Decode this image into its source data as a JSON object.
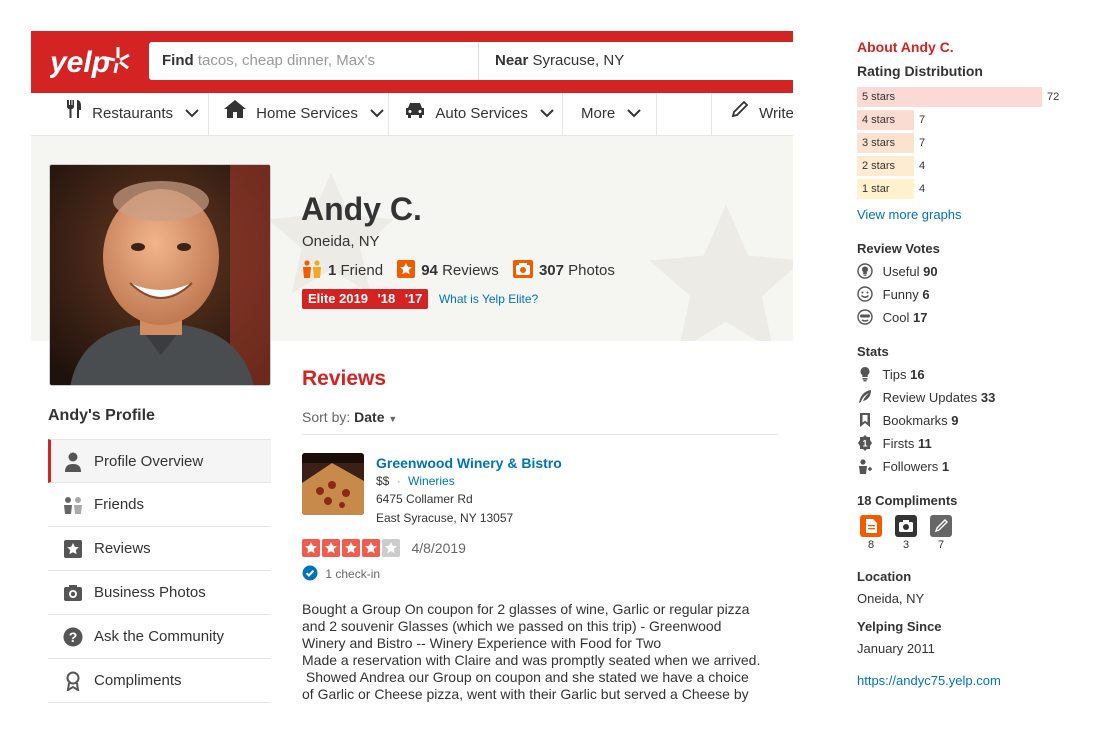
{
  "header": {
    "find_label": "Find",
    "find_placeholder": "tacos, cheap dinner, Max's",
    "near_label": "Near",
    "near_value": "Syracuse, NY"
  },
  "nav": {
    "items": [
      {
        "label": "Restaurants",
        "icon": "fork-knife-icon"
      },
      {
        "label": "Home Services",
        "icon": "house-icon"
      },
      {
        "label": "Auto Services",
        "icon": "car-icon"
      },
      {
        "label": "More",
        "icon": ""
      },
      {
        "label": "Write",
        "icon": "pencil-icon"
      }
    ]
  },
  "profile": {
    "name": "Andy C.",
    "location": "Oneida, NY",
    "friends_count": "1",
    "friends_label": "Friend",
    "reviews_count": "94",
    "reviews_label": "Reviews",
    "photos_count": "307",
    "photos_label": "Photos",
    "elite_years": [
      "Elite 2019",
      "'18",
      "'17"
    ],
    "elite_link": "What is Yelp Elite?"
  },
  "sidebar": {
    "title": "Andy's Profile",
    "items": [
      {
        "label": "Profile Overview",
        "icon": "person-icon",
        "active": true
      },
      {
        "label": "Friends",
        "icon": "friends-icon",
        "active": false
      },
      {
        "label": "Reviews",
        "icon": "star-box-icon",
        "active": false
      },
      {
        "label": "Business Photos",
        "icon": "camera-icon",
        "active": false
      },
      {
        "label": "Ask the Community",
        "icon": "question-icon",
        "active": false
      },
      {
        "label": "Compliments",
        "icon": "ribbon-icon",
        "active": false
      }
    ]
  },
  "reviews": {
    "heading": "Reviews",
    "sort_label": "Sort by:",
    "sort_value": "Date",
    "business_name": "Greenwood Winery & Bistro",
    "price": "$$",
    "separator": "·",
    "category": "Wineries",
    "address_line1": "6475 Collamer Rd",
    "address_line2": "East Syracuse, NY 13057",
    "rating": 4,
    "date": "4/8/2019",
    "checkin": "1 check-in",
    "text_lines": [
      "Bought a Group On coupon  for  2 glasses of wine, Garlic or regular pizza",
      "and 2 souvenir Glasses (which we passed on this trip)  - Greenwood",
      "Winery and Bistro --  Winery Experience with Food for Two",
      "Made a reservation with Claire and was promptly seated when we arrived.",
      " Showed Andrea our Group on coupon and she stated we have a choice",
      "of Garlic or Cheese pizza, went with their Garlic but served a Cheese by"
    ]
  },
  "about": {
    "title": "About Andy C.",
    "rating_title": "Rating Distribution",
    "distribution": [
      {
        "label": "5 stars",
        "count": 72,
        "color": "#fbd9d5"
      },
      {
        "label": "4 stars",
        "count": 7,
        "color": "#fbdcd2"
      },
      {
        "label": "3 stars",
        "count": 7,
        "color": "#fce3cf"
      },
      {
        "label": "2 stars",
        "count": 4,
        "color": "#feebd1"
      },
      {
        "label": "1 star",
        "count": 4,
        "color": "#fff2cc"
      }
    ],
    "view_more": "View more graphs",
    "votes_title": "Review Votes",
    "votes": [
      {
        "label": "Useful",
        "value": "90",
        "icon": "lightbulb-icon"
      },
      {
        "label": "Funny",
        "value": "6",
        "icon": "smile-icon"
      },
      {
        "label": "Cool",
        "value": "17",
        "icon": "sunglasses-icon"
      }
    ],
    "stats_title": "Stats",
    "stats": [
      {
        "label": "Tips",
        "value": "16",
        "icon": "lightbulb-icon"
      },
      {
        "label": "Review Updates",
        "value": "33",
        "icon": "feather-icon"
      },
      {
        "label": "Bookmarks",
        "value": "9",
        "icon": "bookmark-icon"
      },
      {
        "label": "Firsts",
        "value": "11",
        "icon": "badge-icon"
      },
      {
        "label": "Followers",
        "value": "1",
        "icon": "follower-icon"
      }
    ],
    "compliments_title": "18 Compliments",
    "compliments": [
      {
        "count": "8",
        "icon": "document-icon",
        "color": "#f15c00"
      },
      {
        "count": "3",
        "icon": "camera-icon",
        "color": "#333333"
      },
      {
        "count": "7",
        "icon": "pencil-icon",
        "color": "#666666"
      }
    ],
    "location_title": "Location",
    "location": "Oneida, NY",
    "since_title": "Yelping Since",
    "since": "January 2011",
    "website": "https://andyc75.yelp.com"
  },
  "colors": {
    "brand_red": "#d32323",
    "link_blue": "#0073bb",
    "star_red": "#f15c4f"
  }
}
